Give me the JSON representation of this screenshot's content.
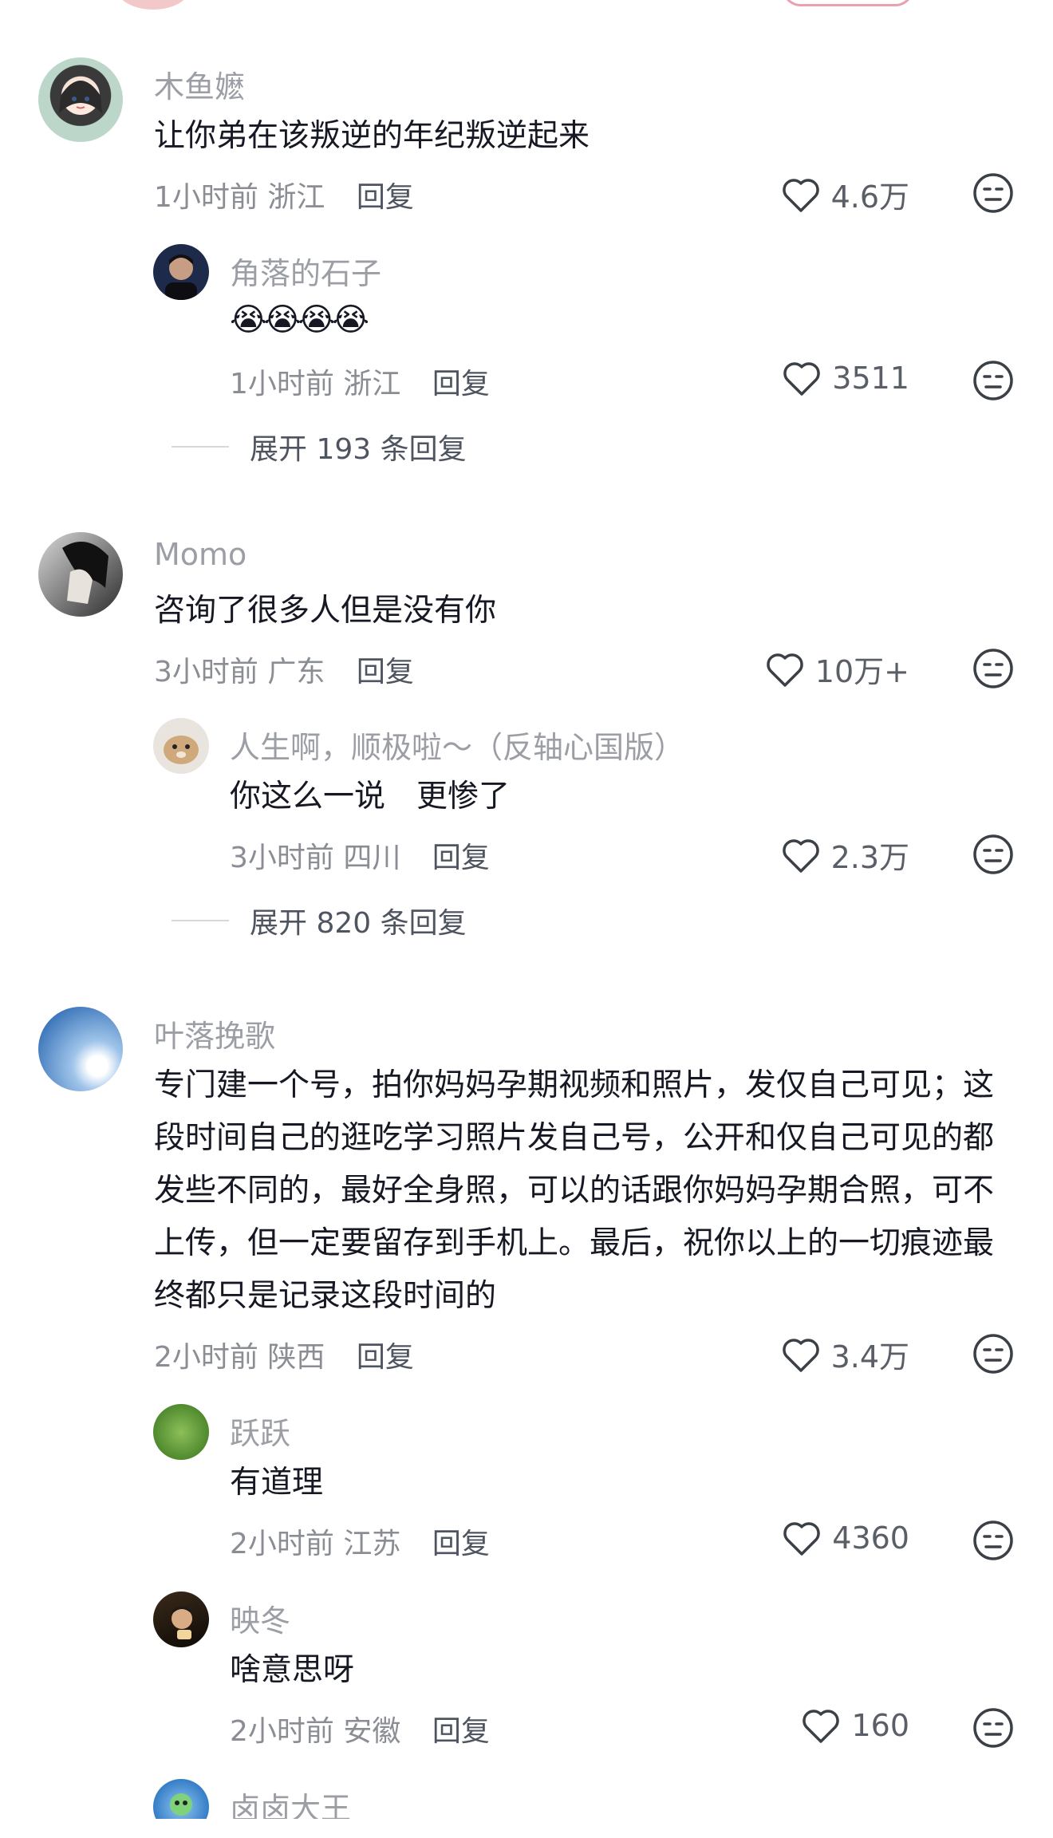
{
  "comments": [
    {
      "name": "木鱼嬷",
      "content": "让你弟在该叛逆的年纪叛逆起来",
      "time": "1小时前",
      "location": "浙江",
      "reply_label": "回复",
      "likes": "4.6万",
      "replies": [
        {
          "name": "角落的石子",
          "content": "😭😭😭😭",
          "time": "1小时前",
          "location": "浙江",
          "reply_label": "回复",
          "likes": "3511"
        }
      ],
      "expand_label": "展开 193 条回复"
    },
    {
      "name": "Momo",
      "content": "咨询了很多人但是没有你",
      "time": "3小时前",
      "location": "广东",
      "reply_label": "回复",
      "likes": "10万+",
      "replies": [
        {
          "name": "人生啊，顺极啦～（反轴心国版）",
          "content": "你这么一说　更惨了",
          "time": "3小时前",
          "location": "四川",
          "reply_label": "回复",
          "likes": "2.3万"
        }
      ],
      "expand_label": "展开 820 条回复"
    },
    {
      "name": "叶落挽歌",
      "content": "专门建一个号，拍你妈妈孕期视频和照片，发仅自己可见；这段时间自己的逛吃学习照片发自己号，公开和仅自己可见的都发些不同的，最好全身照，可以的话跟你妈妈孕期合照，可不上传，但一定要留存到手机上。最后，祝你以上的一切痕迹最终都只是记录这段时间的",
      "time": "2小时前",
      "location": "陕西",
      "reply_label": "回复",
      "likes": "3.4万",
      "replies": [
        {
          "name": "跃跃",
          "content": "有道理",
          "time": "2小时前",
          "location": "江苏",
          "reply_label": "回复",
          "likes": "4360"
        },
        {
          "name": "映冬",
          "content": "啥意思呀",
          "time": "2小时前",
          "location": "安徽",
          "reply_label": "回复",
          "likes": "160"
        },
        {
          "name": "卤卤大王"
        }
      ]
    }
  ],
  "icons": {
    "like": "heart-outline-icon",
    "dislike": "neutral-face-icon"
  },
  "colors": {
    "name": "#9b9ea4",
    "content": "#161823",
    "meta": "#8a8d93",
    "icon": "#3b3f46"
  }
}
